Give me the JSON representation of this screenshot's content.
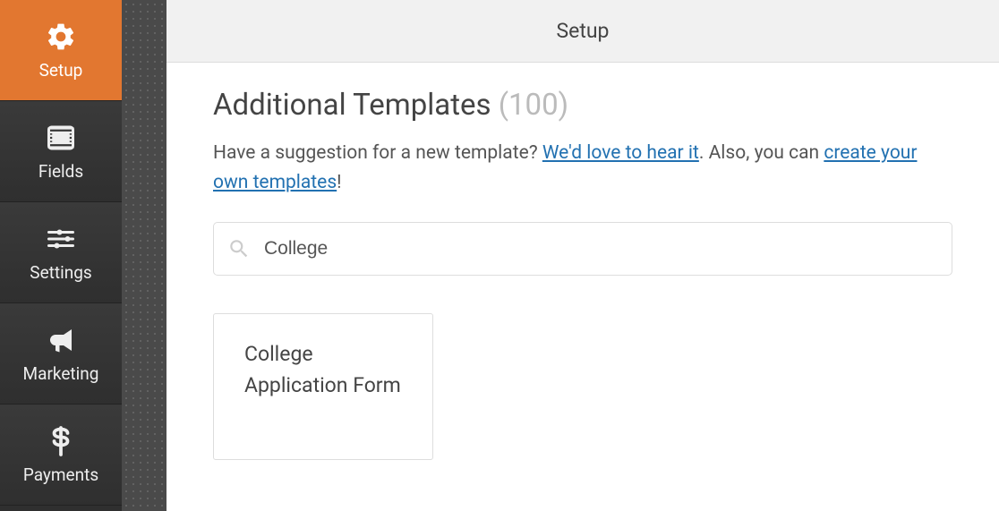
{
  "sidebar": {
    "items": [
      {
        "label": "Setup",
        "icon": "gear-icon",
        "active": true
      },
      {
        "label": "Fields",
        "icon": "list-icon",
        "active": false
      },
      {
        "label": "Settings",
        "icon": "sliders-icon",
        "active": false
      },
      {
        "label": "Marketing",
        "icon": "megaphone-icon",
        "active": false
      },
      {
        "label": "Payments",
        "icon": "dollar-icon",
        "active": false
      }
    ]
  },
  "header": {
    "title": "Setup"
  },
  "section": {
    "heading": "Additional Templates",
    "count": "(100)",
    "description_prefix": "Have a suggestion for a new template? ",
    "link_hear": "We'd love to hear it",
    "description_mid": ". Also, you can ",
    "link_create": "create your own templates",
    "description_suffix": "!"
  },
  "search": {
    "value": "College"
  },
  "templates": [
    {
      "title": "College Application Form"
    }
  ]
}
